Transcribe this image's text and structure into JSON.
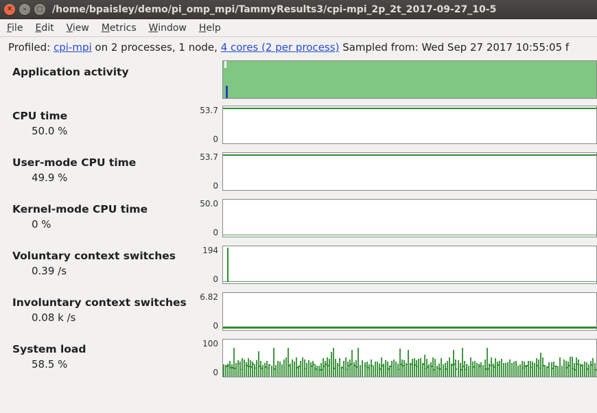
{
  "window": {
    "title": "/home/bpaisley/demo/pi_omp_mpi/TammyResults3/cpi-mpi_2p_2t_2017-09-27_10-5"
  },
  "menu": {
    "file": "File",
    "edit": "Edit",
    "view": "View",
    "metrics": "Metrics",
    "window": "Window",
    "help": "Help"
  },
  "info": {
    "profiled_prefix": "Profiled: ",
    "profiled_link": "cpi-mpi",
    "profiled_mid": " on 2 processes, 1 node, ",
    "cores_link": "4 cores (2 per process)",
    "sampled_label": "   Sampled from: ",
    "sampled_value": "Wed Sep 27 2017 10:55:05 f"
  },
  "metrics": {
    "app_activity": {
      "title": "Application activity"
    },
    "cpu_time": {
      "title": "CPU time",
      "value": "50.0 %",
      "ymax": "53.7",
      "ymin": "0"
    },
    "user_cpu": {
      "title": "User-mode CPU time",
      "value": "49.9 %",
      "ymax": "53.7",
      "ymin": "0"
    },
    "kernel_cpu": {
      "title": "Kernel-mode CPU time",
      "value": "0 %",
      "ymax": "50.0",
      "ymin": "0"
    },
    "vol_ctx": {
      "title": "Voluntary context switches",
      "value": "0.39 /s",
      "ymax": "194",
      "ymin": "0"
    },
    "invol_ctx": {
      "title": "Involuntary context switches",
      "value": "0.08 k /s",
      "ymax": "6.82",
      "ymin": "0"
    },
    "sys_load": {
      "title": "System load",
      "value": "58.5 %",
      "ymax": "100",
      "ymin": "0"
    }
  },
  "chart_data": [
    {
      "type": "area",
      "name": "Application activity",
      "note": "single full-width green band with small white/blue blips at start"
    },
    {
      "type": "line",
      "name": "CPU time",
      "ylim": [
        0,
        53.7
      ],
      "approx_flat_value": 53
    },
    {
      "type": "line",
      "name": "User-mode CPU time",
      "ylim": [
        0,
        53.7
      ],
      "approx_flat_value": 53
    },
    {
      "type": "line",
      "name": "Kernel-mode CPU time",
      "ylim": [
        0,
        50.0
      ],
      "approx_flat_value": 0
    },
    {
      "type": "line",
      "name": "Voluntary context switches",
      "ylim": [
        0,
        194
      ],
      "baseline": 0,
      "spikes": [
        {
          "pos_pct": 2,
          "h_pct": 95
        }
      ]
    },
    {
      "type": "line",
      "name": "Involuntary context switches",
      "ylim": [
        0,
        6.82
      ],
      "baseline_noise_pct": 6
    },
    {
      "type": "line",
      "name": "System load",
      "ylim": [
        0,
        100
      ],
      "mean_pct": 58.5,
      "noisy": true
    }
  ]
}
